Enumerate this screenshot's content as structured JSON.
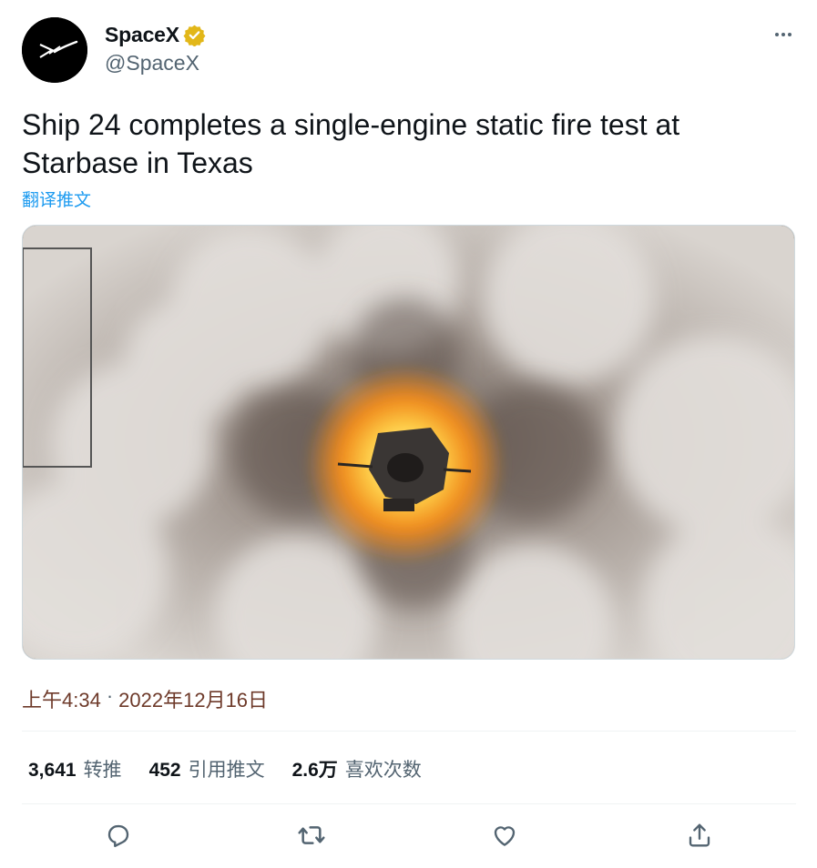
{
  "author": {
    "display_name": "SpaceX",
    "handle": "@SpaceX",
    "verified": true
  },
  "tweet": {
    "text": "Ship 24 completes a single-engine static fire test at Starbase in Texas",
    "translate_label": "翻译推文",
    "time": "上午4:34",
    "separator": "·",
    "date": "2022年12月16日"
  },
  "stats": [
    {
      "value": "3,641",
      "label": "转推"
    },
    {
      "value": "452",
      "label": "引用推文"
    },
    {
      "value": "2.6万",
      "label": "喜欢次数"
    }
  ],
  "actions": [
    "reply-icon",
    "retweet-icon",
    "like-icon",
    "share-icon"
  ],
  "colors": {
    "accent": "#1d9bf0",
    "secondary_text": "#536471",
    "verified_badge": "#e2b719",
    "divider": "#eff3f4"
  }
}
